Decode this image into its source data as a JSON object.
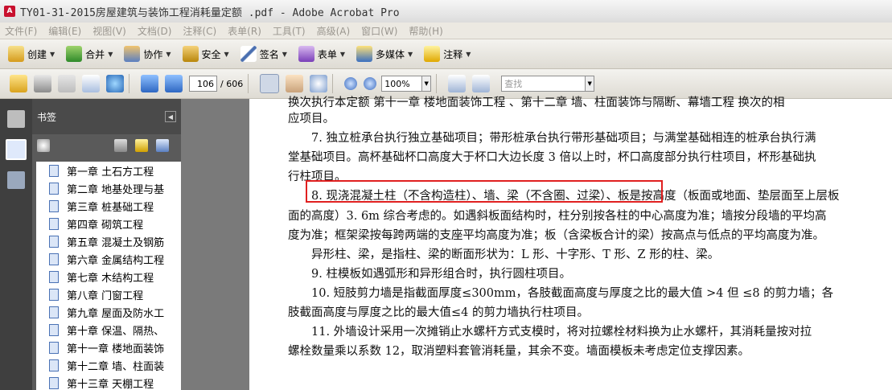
{
  "window": {
    "title": "TY01-31-2015房屋建筑与装饰工程消耗量定额  .pdf - Adobe Acrobat Pro"
  },
  "menu": [
    "文件(F)",
    "编辑(E)",
    "视图(V)",
    "文档(D)",
    "注释(C)",
    "表单(R)",
    "工具(T)",
    "高级(A)",
    "窗口(W)",
    "帮助(H)"
  ],
  "toolbar1": [
    {
      "label": "创建"
    },
    {
      "label": "合并"
    },
    {
      "label": "协作"
    },
    {
      "label": "安全"
    },
    {
      "label": "签名"
    },
    {
      "label": "表单"
    },
    {
      "label": "多媒体"
    },
    {
      "label": "注释"
    }
  ],
  "toolbar2": {
    "page_current": "106",
    "page_total": "/ 606",
    "zoom": "100%",
    "search_placeholder": "查找"
  },
  "sidebar": {
    "title": "书签",
    "bookmarks": [
      "第一章 土石方工程",
      "第二章 地基处理与基",
      "第三章 桩基础工程",
      "第四章 砌筑工程",
      "第五章 混凝土及钢筋",
      "第六章 金属结构工程",
      "第七章 木结构工程",
      "第八章 门窗工程",
      "第九章 屋面及防水工",
      "第十章 保温、隔热、",
      "第十一章 楼地面装饰",
      "第十二章 墙、柱面装",
      "第十三章 天棚工程"
    ]
  },
  "document": {
    "lines": [
      "换次执行本定额 第十一章  楼地面装饰工程 、第十二章 墙、柱面装饰与隔断、幕墙工程 换次的相",
      "应项目。",
      "　　7. 独立桩承台执行独立基础项目；带形桩承台执行带形基础项目；与满堂基础相连的桩承台执行满",
      "堂基础项目。高杯基础杯口高度大于杯口大边长度 3 倍以上时，杯口高度部分执行柱项目，杯形基础执",
      "行柱项目。",
      "　　8. 现浇混凝土柱（不含构造柱）、墙、梁（不含圈、过梁）、板是按高度（板面或地面、垫层面至上层板",
      "面的高度）3. 6m 综合考虑的。如遇斜板面结构时，柱分别按各柱的中心高度为准；墙按分段墙的平均高",
      "度为准；框架梁按每跨两端的支座平均高度为准；板（含梁板合计的梁）按高点与低点的平均高度为准。",
      "　　异形柱、梁，是指柱、梁的断面形状为：L 形、十字形、T 形、Z 形的柱、梁。",
      "　　9. 柱模板如遇弧形和异形组合时，执行圆柱项目。",
      "　　10. 短肢剪力墙是指截面厚度≤300mm，各肢截面高度与厚度之比的最大值 >4 但 ≤8 的剪力墙；各",
      "肢截面高度与厚度之比的最大值≤4 的剪力墙执行柱项目。",
      "　　11. 外墙设计采用一次摊销止水螺杆方式支模时，将对拉螺栓材料换为止水螺杆，其消耗量按对拉",
      "螺栓数量乘以系数 12，取消塑料套管消耗量，其余不变。墙面模板未考虑定位支撑因素。"
    ]
  }
}
